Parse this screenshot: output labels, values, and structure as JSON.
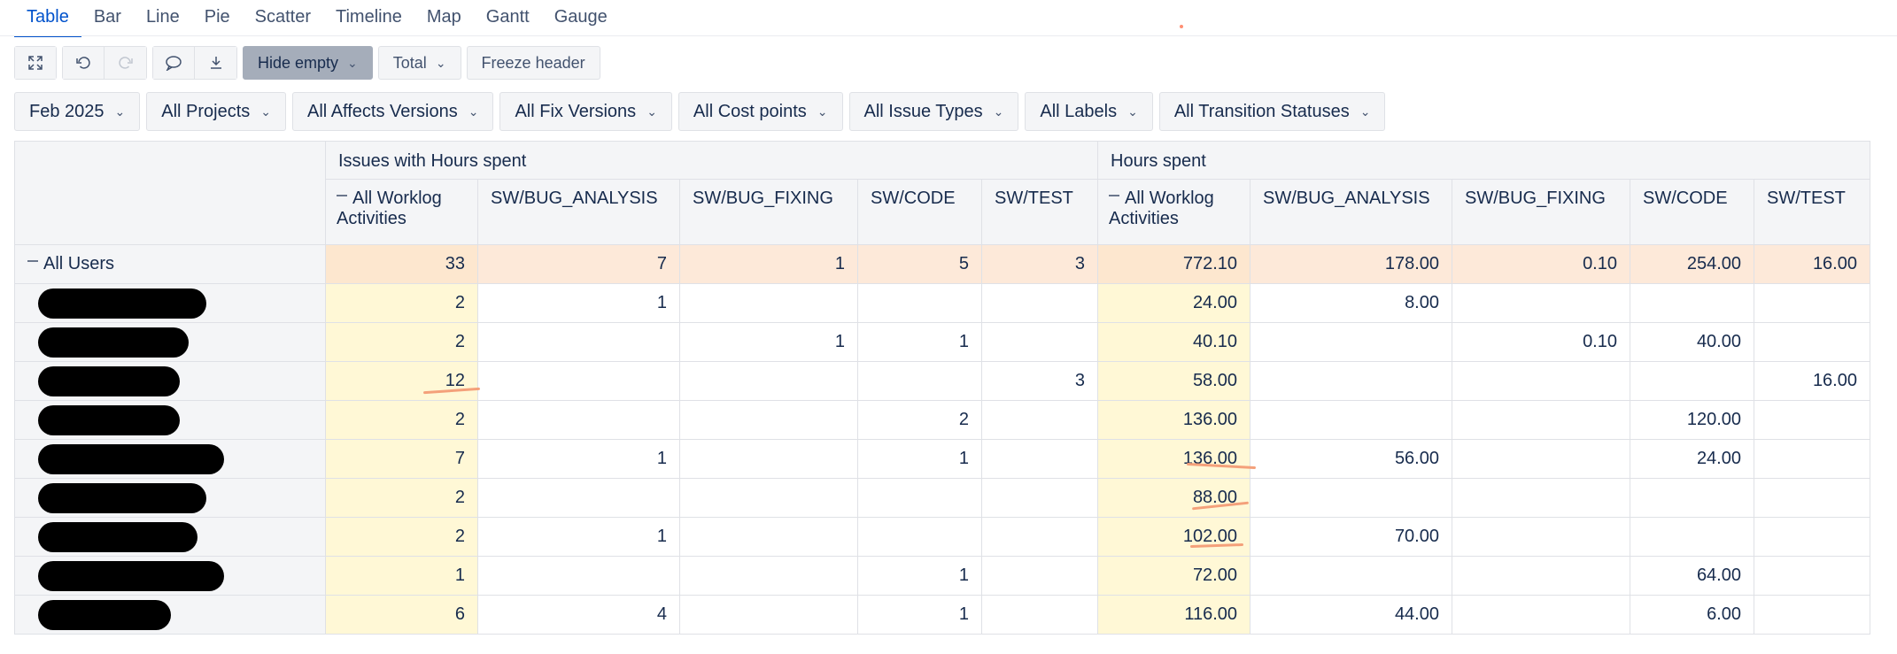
{
  "tabs": [
    "Table",
    "Bar",
    "Line",
    "Pie",
    "Scatter",
    "Timeline",
    "Map",
    "Gantt",
    "Gauge"
  ],
  "toolbar": {
    "hide_empty": "Hide empty",
    "total": "Total",
    "freeze_header": "Freeze header"
  },
  "filters": [
    "Feb 2025",
    "All Projects",
    "All Affects Versions",
    "All Fix Versions",
    "All Cost points",
    "All Issue Types",
    "All Labels",
    "All Transition Statuses"
  ],
  "table": {
    "group_issues": "Issues with Hours spent",
    "group_hours": "Hours spent",
    "columns": [
      "All Worklog Activities",
      "SW/BUG_ANALYSIS",
      "SW/BUG_FIXING",
      "SW/CODE",
      "SW/TEST"
    ],
    "all_users_label": "All Users",
    "total_row": {
      "issues": [
        "33",
        "7",
        "1",
        "5",
        "3"
      ],
      "hours": [
        "772.10",
        "178.00",
        "0.10",
        "254.00",
        "16.00"
      ]
    },
    "rows": [
      {
        "issues": [
          "2",
          "1",
          "",
          "",
          ""
        ],
        "hours": [
          "24.00",
          "8.00",
          "",
          "",
          ""
        ]
      },
      {
        "issues": [
          "2",
          "",
          "1",
          "1",
          ""
        ],
        "hours": [
          "40.10",
          "",
          "0.10",
          "40.00",
          ""
        ]
      },
      {
        "issues": [
          "12",
          "",
          "",
          "",
          "3"
        ],
        "hours": [
          "58.00",
          "",
          "",
          "",
          "16.00"
        ]
      },
      {
        "issues": [
          "2",
          "",
          "",
          "2",
          ""
        ],
        "hours": [
          "136.00",
          "",
          "",
          "120.00",
          ""
        ]
      },
      {
        "issues": [
          "7",
          "1",
          "",
          "1",
          ""
        ],
        "hours": [
          "136.00",
          "56.00",
          "",
          "24.00",
          ""
        ]
      },
      {
        "issues": [
          "2",
          "",
          "",
          "",
          ""
        ],
        "hours": [
          "88.00",
          "",
          "",
          "",
          ""
        ]
      },
      {
        "issues": [
          "2",
          "1",
          "",
          "",
          ""
        ],
        "hours": [
          "102.00",
          "70.00",
          "",
          "",
          ""
        ]
      },
      {
        "issues": [
          "1",
          "",
          "",
          "1",
          ""
        ],
        "hours": [
          "72.00",
          "",
          "",
          "64.00",
          ""
        ]
      },
      {
        "issues": [
          "6",
          "4",
          "",
          "1",
          ""
        ],
        "hours": [
          "116.00",
          "44.00",
          "",
          "6.00",
          ""
        ]
      }
    ]
  },
  "icons": [
    "expand-icon",
    "undo-icon",
    "redo-icon",
    "comment-icon",
    "download-icon",
    "chevron-down-icon",
    "collapse-minus-icon"
  ],
  "colors": {
    "accent": "#0052cc",
    "highlight_column": "#fff8d6",
    "total_row": "#fde9d9",
    "annotation": "#f4a07a"
  }
}
